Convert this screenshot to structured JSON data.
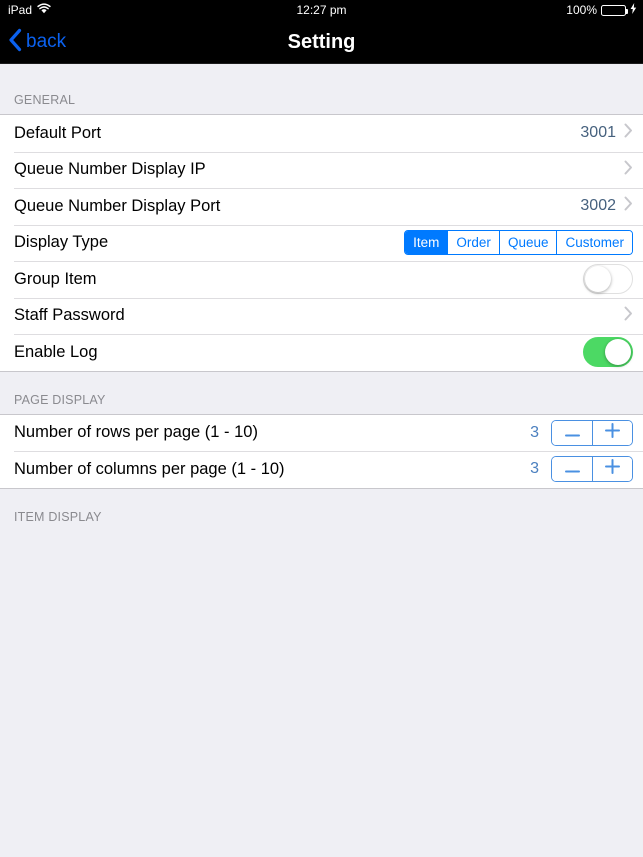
{
  "status_bar": {
    "device": "iPad",
    "wifi_icon": "wifi-icon",
    "time": "12:27 pm",
    "battery_percent": "100%",
    "battery_icon": "battery-icon",
    "charging_icon": "lightning-bolt-icon"
  },
  "nav_bar": {
    "back_label": "back",
    "back_icon": "chevron-left-icon",
    "title": "Setting"
  },
  "sections": [
    {
      "header": "GENERAL",
      "rows": [
        {
          "label": "Default Port",
          "value": "3001",
          "accessory": "disclosure"
        },
        {
          "label": "Queue Number Display IP",
          "value": "",
          "accessory": "disclosure"
        },
        {
          "label": "Queue Number Display Port",
          "value": "3002",
          "accessory": "disclosure"
        },
        {
          "label": "Display Type",
          "accessory": "segmented"
        },
        {
          "label": "Group Item",
          "accessory": "switch-off"
        },
        {
          "label": "Staff Password",
          "value": "",
          "accessory": "disclosure"
        },
        {
          "label": "Enable Log",
          "accessory": "switch-on"
        }
      ]
    },
    {
      "header": "PAGE DISPLAY",
      "rows": [
        {
          "label": "Number of rows per page (1 - 10)",
          "value": "3",
          "accessory": "stepper"
        },
        {
          "label": "Number of columns per page (1 - 10)",
          "value": "3",
          "accessory": "stepper"
        }
      ]
    },
    {
      "header": "ITEM DISPLAY",
      "rows": []
    }
  ],
  "display_type": {
    "options": [
      "Item",
      "Order",
      "Queue",
      "Customer"
    ],
    "selected": "Item"
  },
  "stepper": {
    "decrement_label": "−",
    "increment_label": "+"
  },
  "colors": {
    "accent_blue": "#007AFF",
    "back_blue": "#0B61EE",
    "switch_on_green": "#4CD964",
    "value_slate": "#46617E",
    "stepper_blue": "#4A90E2",
    "group_bg": "#EFEFF4",
    "separator": "#C8C7CC",
    "section_header_text": "#8A8A8F"
  }
}
